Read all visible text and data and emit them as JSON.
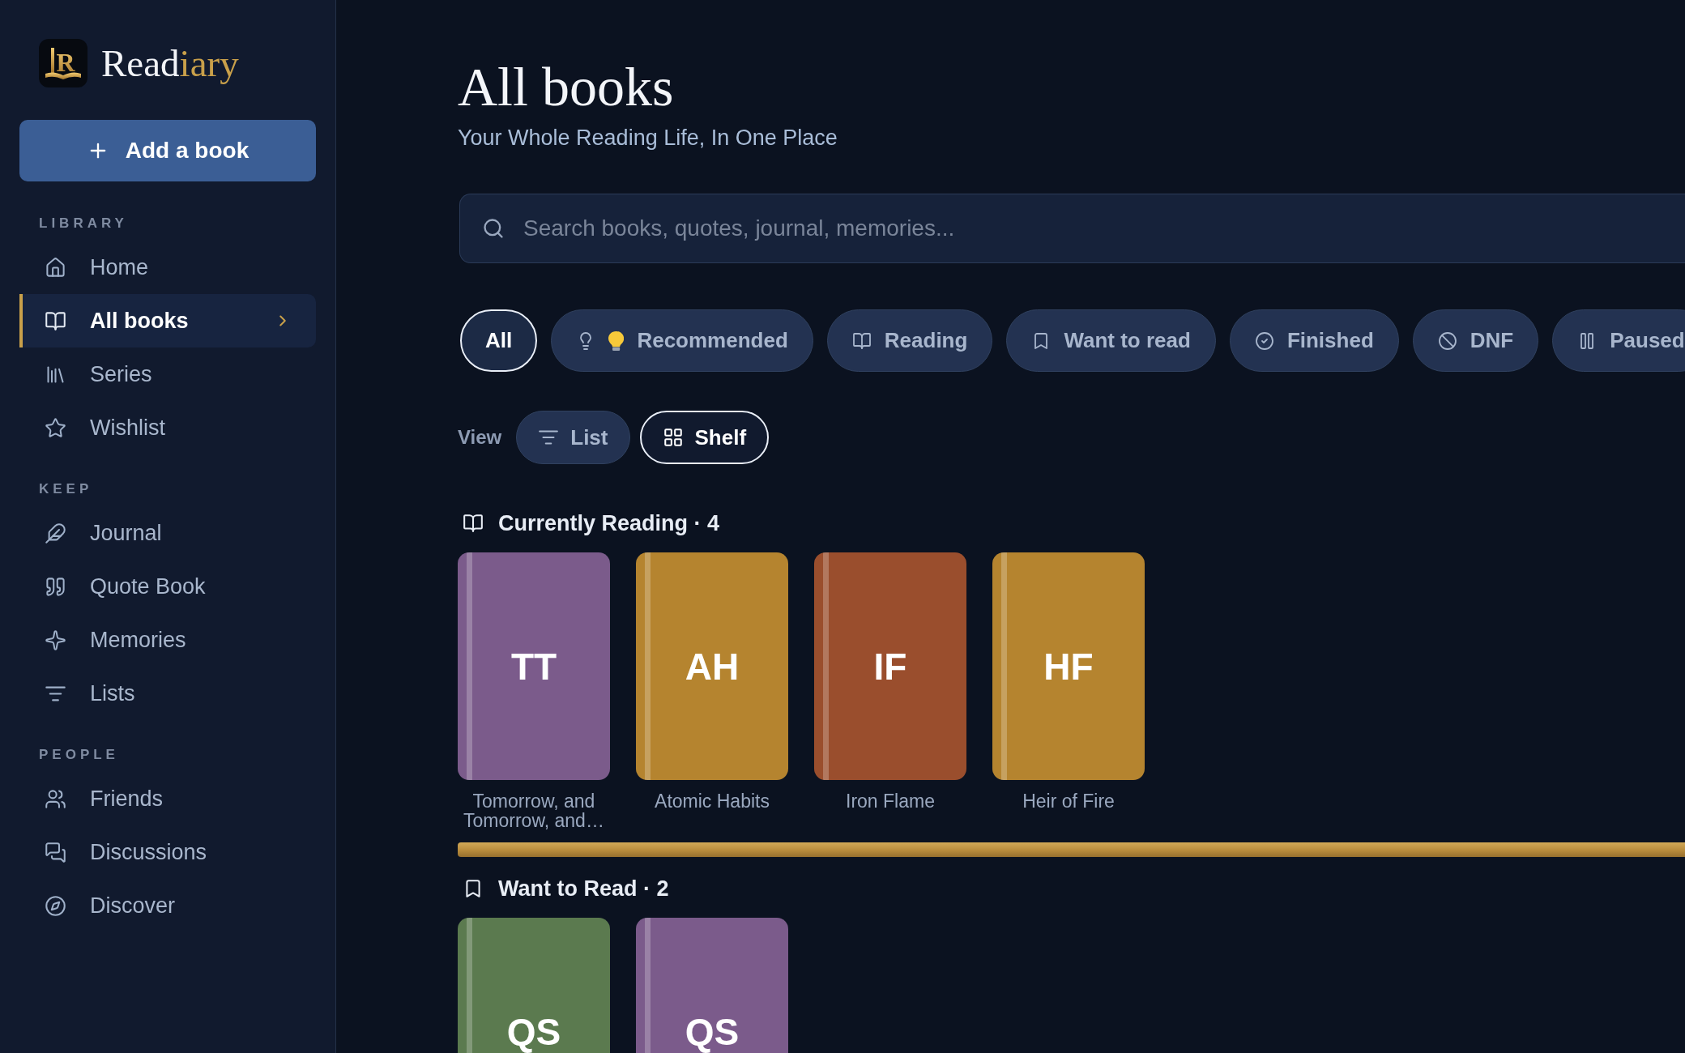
{
  "sidebar": {
    "brand": {
      "logo_letter": "R",
      "name_start": "Read",
      "name_end": "iary"
    },
    "add_button": {
      "label": "Add a book"
    },
    "sections": [
      {
        "heading": "LIBRARY",
        "items": [
          {
            "label": "Home",
            "selected": false
          },
          {
            "label": "All books",
            "selected": true
          },
          {
            "label": "Series",
            "selected": false
          },
          {
            "label": "Wishlist",
            "selected": false
          }
        ]
      },
      {
        "heading": "KEEP",
        "items": [
          {
            "label": "Journal",
            "selected": false
          },
          {
            "label": "Quote Book",
            "selected": false
          },
          {
            "label": "Memories",
            "selected": false
          },
          {
            "label": "Lists",
            "selected": false
          }
        ]
      },
      {
        "heading": "PEOPLE",
        "items": [
          {
            "label": "Friends",
            "selected": false
          },
          {
            "label": "Discussions",
            "selected": false
          },
          {
            "label": "Discover",
            "selected": false
          }
        ]
      }
    ]
  },
  "header": {
    "title": "All books",
    "subtitle": "Your Whole Reading Life, In One Place"
  },
  "search": {
    "placeholder": "Search books, quotes, journal, memories..."
  },
  "filters": [
    {
      "label": "All",
      "selected": true
    },
    {
      "label": "Recommended",
      "selected": false
    },
    {
      "label": "Reading",
      "selected": false
    },
    {
      "label": "Want to read",
      "selected": false
    },
    {
      "label": "Finished",
      "selected": false
    },
    {
      "label": "DNF",
      "selected": false
    },
    {
      "label": "Paused",
      "selected": false
    }
  ],
  "view": {
    "label": "View",
    "options": [
      {
        "label": "List",
        "selected": false
      },
      {
        "label": "Shelf",
        "selected": true
      }
    ]
  },
  "shelves": [
    {
      "heading": "Currently Reading · 4",
      "books": [
        {
          "initials": "TT",
          "title": "Tomorrow, and Tomorrow, and…",
          "color": "#7b5b8b"
        },
        {
          "initials": "AH",
          "title": "Atomic Habits",
          "color": "#b5842f"
        },
        {
          "initials": "IF",
          "title": "Iron Flame",
          "color": "#9a4e2d"
        },
        {
          "initials": "HF",
          "title": "Heir of Fire",
          "color": "#b5842f"
        }
      ]
    },
    {
      "heading": "Want to Read · 2",
      "books": [
        {
          "initials": "QS",
          "color": "#5b7a4f"
        },
        {
          "initials": "QS",
          "color": "#7b5b8b"
        }
      ]
    }
  ]
}
